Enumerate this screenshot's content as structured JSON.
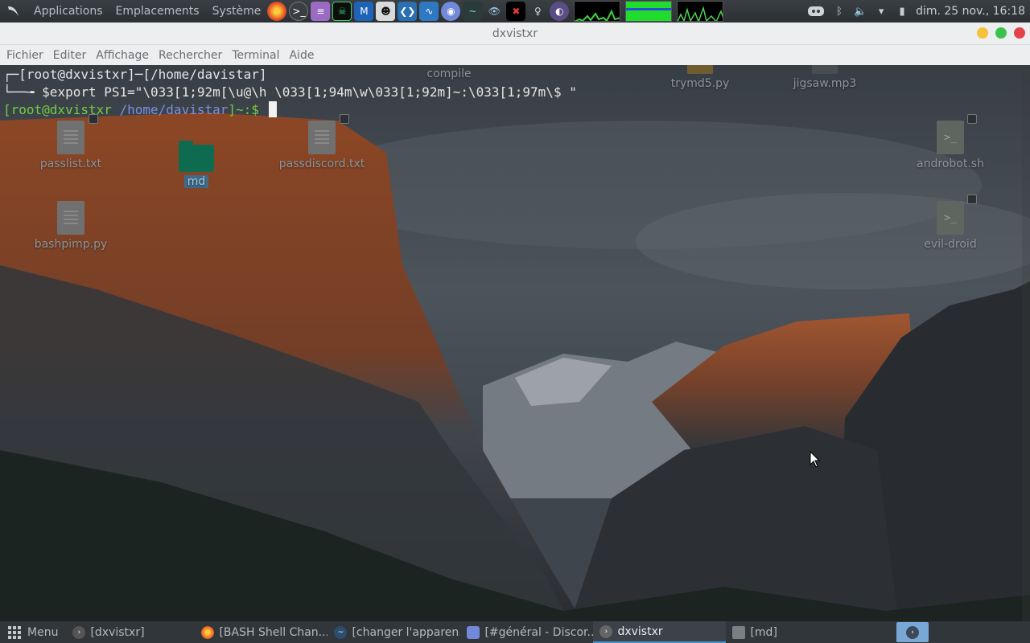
{
  "top_panel": {
    "menus": [
      "Applications",
      "Emplacements",
      "Système"
    ],
    "launchers": [
      "firefox-icon",
      "terminal-icon",
      "text-editor-icon",
      "hacker-app-icon",
      "malwarebytes-icon",
      "anonymous-mask-icon",
      "vscode-icon",
      "wireshark-icon",
      "discord-icon",
      "kali-dragon-icon",
      "eye-icon",
      "skull-icon",
      "lightbulb-icon",
      "moon-icon"
    ],
    "clock": "dim. 25 nov., 16:18",
    "tray": [
      "discord-tray-icon",
      "bluetooth-icon",
      "volume-icon",
      "wifi-icon",
      "battery-icon"
    ]
  },
  "window": {
    "title": "dxvistxr",
    "menu": [
      "Fichier",
      "Editer",
      "Affichage",
      "Rechercher",
      "Terminal",
      "Aide"
    ]
  },
  "terminal": {
    "line1": "┌─[root@dxvistxr]─[/home/davistar]",
    "line2_prefix": "└──╼ ",
    "line2_cmd": "$export PS1=\"\\033[1;92m[\\u@\\h \\033[1;94m\\w\\033[1;92m]~:\\033[1;97m\\$ \"",
    "prompt_user": "[root@dxvistxr ",
    "prompt_path": "/home/davistar",
    "prompt_end": "]~:$ "
  },
  "desktop_icons": {
    "compile": "compile",
    "trymd5": "trymd5.py",
    "jigsaw": "jigsaw.mp3",
    "passlist": "passlist.txt",
    "md": "md",
    "passdiscord": "passdiscord.txt",
    "androbot": "androbot.sh",
    "bashpimp": "bashpimp.py",
    "evil_droid": "evil-droid"
  },
  "taskbar": {
    "start_label": "Menu",
    "tasks": [
      {
        "label": "[dxvistxr]",
        "icon": "terminal-icon"
      },
      {
        "label": "[BASH Shell Chan...",
        "icon": "firefox-icon"
      },
      {
        "label": "[changer l'apparen...",
        "icon": "kali-dragon-icon"
      },
      {
        "label": "[#général - Discor...",
        "icon": "discord-icon"
      },
      {
        "label": "dxvistxr",
        "icon": "terminal-icon"
      },
      {
        "label": "[md]",
        "icon": "folder-icon"
      }
    ]
  },
  "colors": {
    "prompt_green": "#6fcf3f",
    "prompt_blue": "#7b8fe0",
    "accent": "#3f94cf"
  }
}
